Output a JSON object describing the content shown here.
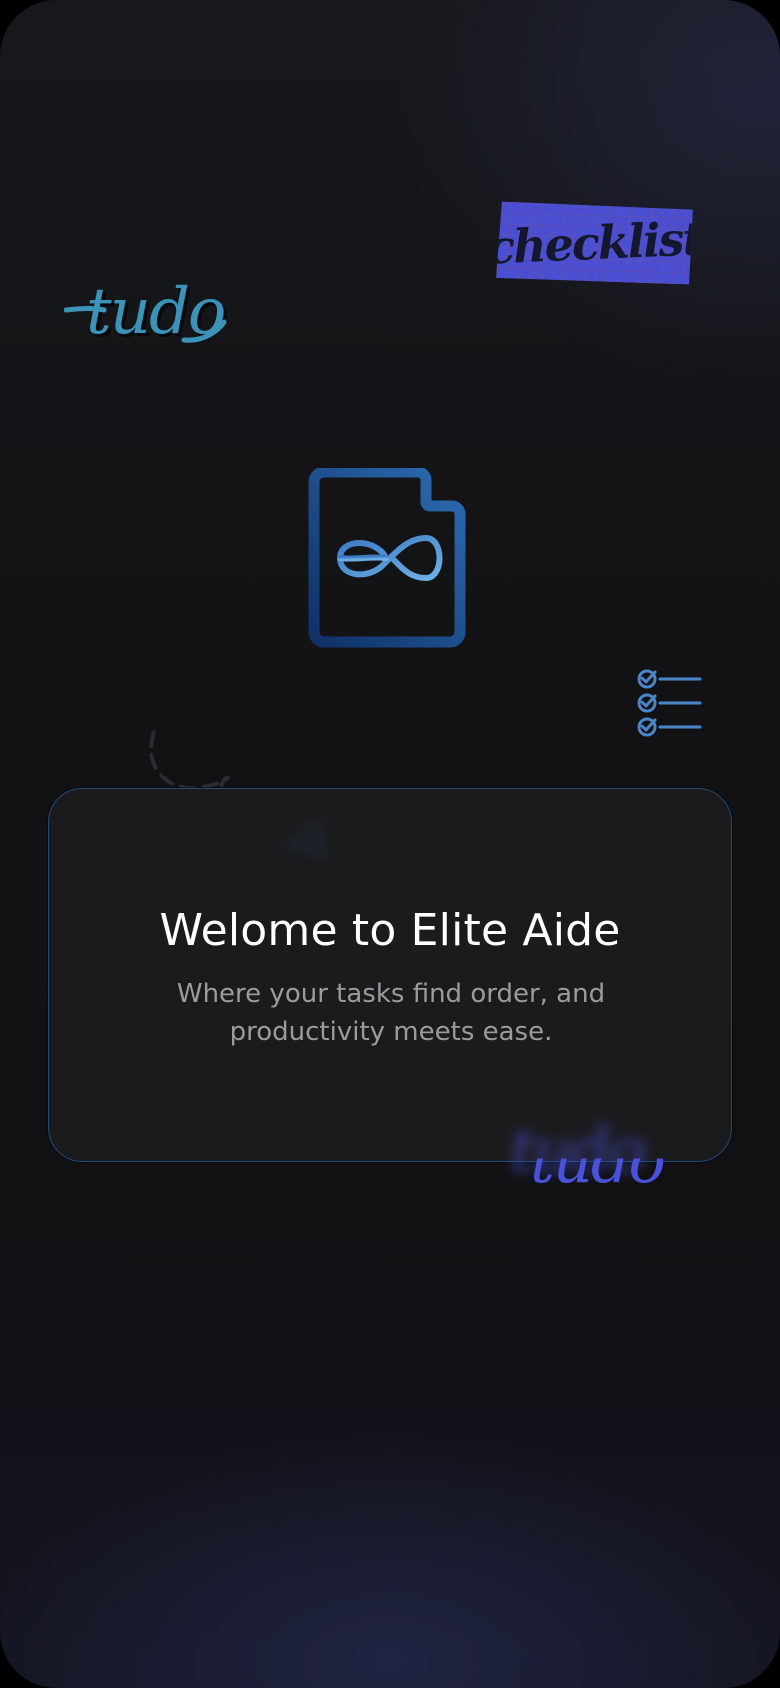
{
  "welcome": {
    "title": "Welome to Elite Aide",
    "subtitle": "Where your tasks find order, and productivity meets ease."
  },
  "decorations": {
    "tudo_top": "tudo",
    "checklist_sticker": "checklist",
    "tudo_bottom": "tudo"
  },
  "icons": {
    "app_logo": "infinity-document-icon",
    "checklist": "checklist-icon",
    "arrow": "paper-plane-icon"
  },
  "colors": {
    "background": "#121214",
    "card": "#1c1c1e",
    "card_border": "#1f4d7a",
    "accent_blue": "#2a64a8",
    "sticker": "#4a4fd1",
    "tudo_top": "#3b93b8",
    "tudo_bottom": "#4a52dc",
    "subtitle": "#9b9b9e"
  }
}
